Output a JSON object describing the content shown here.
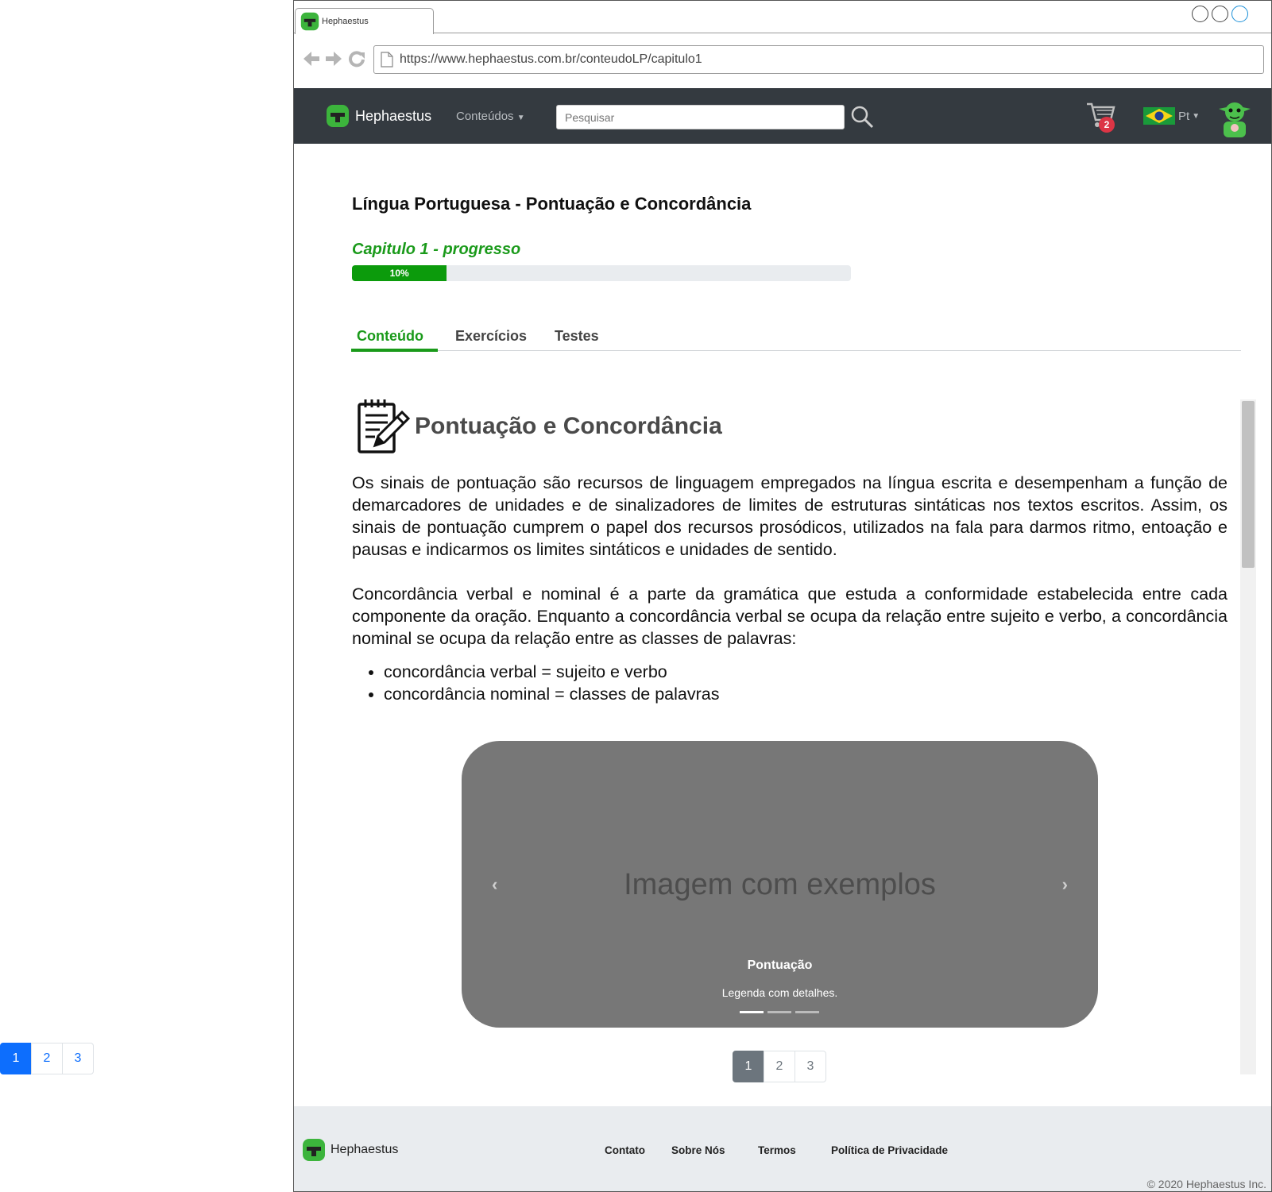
{
  "side_pagination": [
    "1",
    "2",
    "3"
  ],
  "browser": {
    "tab_title": "Hephaestus",
    "url": "https://www.hephaestus.com.br/conteudoLP/capitulo1"
  },
  "navbar": {
    "brand": "Hephaestus",
    "menu_label": "Conteúdos",
    "search_placeholder": "Pesquisar",
    "cart_count": "2",
    "language": "Pt"
  },
  "page": {
    "title": "Língua Portuguesa - Pontuação e Concordância",
    "progress_title": "Capitulo 1 - progresso",
    "progress_label": "10%",
    "progress_value": 0.1,
    "tabs": [
      {
        "label": "Conteúdo",
        "active": true
      },
      {
        "label": "Exercícios",
        "active": false
      },
      {
        "label": "Testes",
        "active": false
      }
    ],
    "section_title": "Pontuação e Concordância",
    "paragraph1": "Os sinais de pontuação são recursos de linguagem empregados na língua escrita e desempenham a função de demarcadores de unidades e de sinalizadores de limites de estruturas sintáticas nos textos escritos. Assim, os sinais de pontuação cumprem o papel dos recursos prosódicos, utilizados na fala para darmos ritmo, entoação e pausas e indicarmos os limites sintáticos e unidades de sentido.",
    "paragraph2": "Concordância verbal e nominal é a parte da gramática que estuda a conformidade estabelecida entre cada componente da oração. Enquanto a concordância verbal se ocupa da relação entre sujeito e verbo, a concordância nominal se ocupa da relação entre as classes de palavras:",
    "bullets": [
      "concordância verbal = sujeito e verbo",
      "concordância nominal = classes de palavras"
    ]
  },
  "carousel": {
    "placeholder": "Imagem com exemplos",
    "caption_title": "Pontuação",
    "caption_text": "Legenda com detalhes.",
    "prev_icon": "chevron-left-icon",
    "next_icon": "chevron-right-icon",
    "slides": 3,
    "active_slide": 1
  },
  "content_pagination": [
    "1",
    "2",
    "3"
  ],
  "footer": {
    "brand": "Hephaestus",
    "links": [
      "Contato",
      "Sobre Nós",
      "Termos",
      "Política de Privacidade"
    ],
    "copyright": "© 2020 Hephaestus Inc."
  },
  "colors": {
    "accent_green": "#1a9a1a",
    "navbar_bg": "#343a40",
    "badge_red": "#dc3545",
    "primary_blue": "#0d6efd"
  }
}
